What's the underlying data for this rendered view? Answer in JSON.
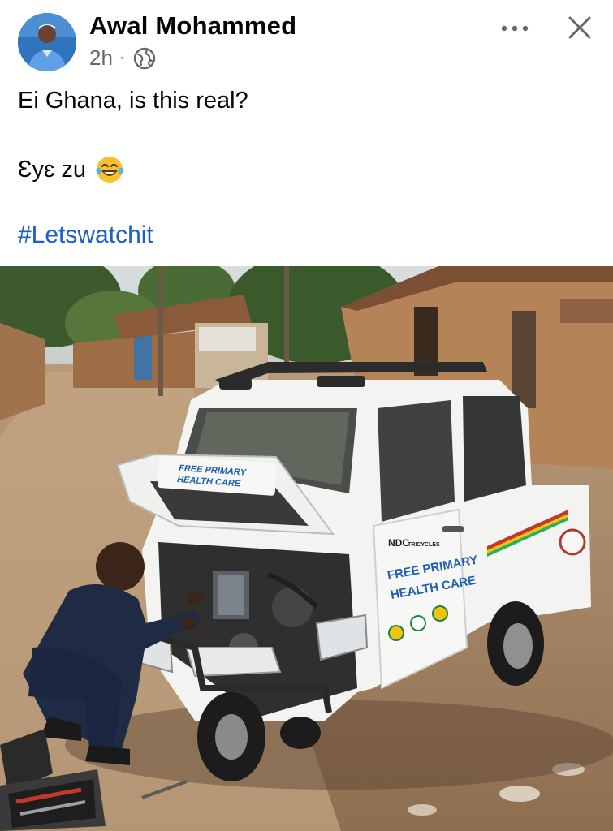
{
  "post": {
    "author": {
      "name": "Awal Mohammed",
      "avatar_icon": "profile-photo"
    },
    "meta": {
      "time": "2h",
      "separator": "·",
      "audience_icon": "globe-icon"
    },
    "actions": {
      "more_label": "•••",
      "close_label": "✕"
    },
    "text": {
      "line1": "Ei Ghana, is this real?",
      "line2": "Ɛyɛ zu",
      "line2_emoji": "face-with-tears-of-joy",
      "hashtag": "#Letswatchit"
    },
    "photo": {
      "hood_label_line1": "FREE PRIMARY",
      "hood_label_line2": "HEALTH CARE",
      "door_label_line1": "FREE PRIMARY",
      "door_label_line2": "HEALTH CARE",
      "door_badge": "NDC",
      "door_badge_sub": "TRICYCLES"
    }
  }
}
